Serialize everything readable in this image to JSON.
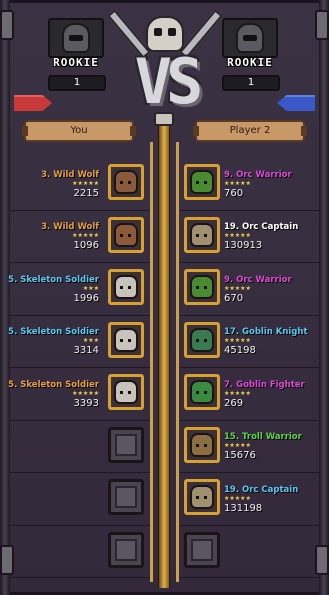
{
  "colors": {
    "bronze": "#e8a040",
    "cyan": "#58c8f0",
    "magenta": "#e048d8",
    "white": "#ffffff",
    "green": "#58d848",
    "star": "#f0d050"
  },
  "header": {
    "vs_text": "VS",
    "left_player": {
      "rank": "ROOKIE",
      "rank_number": "1",
      "banner_name": "You",
      "avatar_icon": "knight-helmet-icon"
    },
    "right_player": {
      "rank": "ROOKIE",
      "rank_number": "1",
      "banner_name": "Player 2",
      "avatar_icon": "knight-helmet-icon"
    }
  },
  "left_units": [
    {
      "name": "3. Wild Wolf",
      "stars": "★★★★★",
      "power": "2215",
      "color": "bronze",
      "icon": "wolf-icon",
      "face": "#8a5a3a"
    },
    {
      "name": "3. Wild Wolf",
      "stars": "★★★★★",
      "power": "1096",
      "color": "bronze",
      "icon": "wolf-icon",
      "face": "#8a5a3a"
    },
    {
      "name": "5. Skeleton Soldier",
      "stars": "★★★",
      "power": "1996",
      "color": "cyan",
      "icon": "skeleton-icon",
      "face": "#c8c4bc"
    },
    {
      "name": "5. Skeleton Soldier",
      "stars": "★★★",
      "power": "3314",
      "color": "cyan",
      "icon": "skeleton-icon",
      "face": "#c8c4bc"
    },
    {
      "name": "5. Skeleton Soldier",
      "stars": "★★★★★",
      "power": "3393",
      "color": "bronze",
      "icon": "skeleton-icon",
      "face": "#c8c4bc"
    },
    {
      "empty": true
    },
    {
      "empty": true
    },
    {
      "empty": true
    }
  ],
  "right_units": [
    {
      "name": "9. Orc Warrior",
      "stars": "★★★★★",
      "power": "760",
      "color": "magenta",
      "icon": "orc-icon",
      "face": "#4a8a30"
    },
    {
      "name": "19. Orc Captain",
      "stars": "★★★★★",
      "power": "130913",
      "color": "white",
      "icon": "orc-captain-icon",
      "face": "#a09070"
    },
    {
      "name": "9. Orc Warrior",
      "stars": "★★★★★",
      "power": "670",
      "color": "magenta",
      "icon": "orc-icon",
      "face": "#4a8a30"
    },
    {
      "name": "17. Goblin Knight",
      "stars": "★★★★★",
      "power": "45198",
      "color": "cyan",
      "icon": "goblin-knight-icon",
      "face": "#3a7a50"
    },
    {
      "name": "7. Goblin Fighter",
      "stars": "★★★★★",
      "power": "269",
      "color": "magenta",
      "icon": "goblin-icon",
      "face": "#3a8a40"
    },
    {
      "name": "15. Troll Warrior",
      "stars": "★★★★★",
      "power": "15676",
      "color": "green",
      "icon": "troll-icon",
      "face": "#8a7040"
    },
    {
      "name": "19. Orc Captain",
      "stars": "★★★★★",
      "power": "131198",
      "color": "cyan",
      "icon": "orc-captain-icon",
      "face": "#a09070"
    },
    {
      "empty": true
    }
  ]
}
